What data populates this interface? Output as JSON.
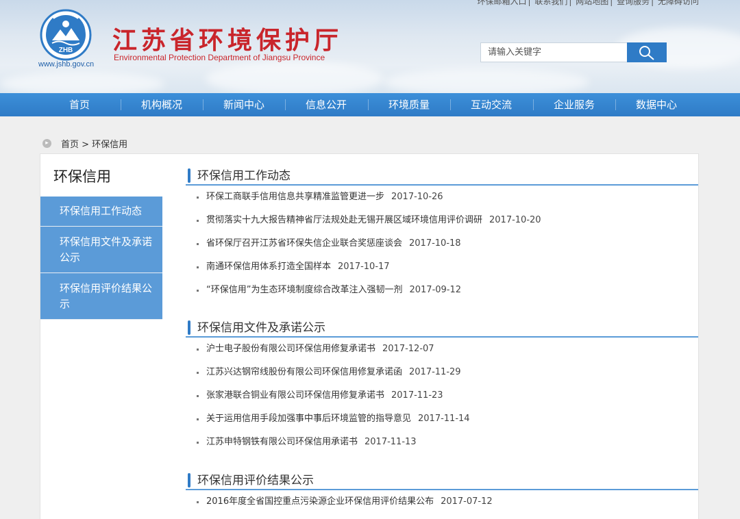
{
  "header": {
    "top_links": [
      "环保邮箱入口",
      "联系我们",
      "网站地图",
      "查询服务",
      "无障碍访问"
    ],
    "logo_text": "ZHB",
    "site_url": "www.jshb.gov.cn",
    "title": "江苏省环境保护厅",
    "subtitle": "Environmental Protection Department of Jiangsu Province",
    "search": {
      "placeholder": "请输入关键字",
      "icon": "search-icon"
    }
  },
  "nav": {
    "items": [
      "首页",
      "机构概况",
      "新闻中心",
      "信息公开",
      "环境质量",
      "互动交流",
      "企业服务",
      "数据中心"
    ]
  },
  "breadcrumb": {
    "icon": "arrow-right-circle-icon",
    "text": "首页 > 环保信用"
  },
  "sidebar": {
    "title": "环保信用",
    "items": [
      "环保信用工作动态",
      "环保信用文件及承诺公示",
      "环保信用评价结果公示"
    ]
  },
  "sections": [
    {
      "title": "环保信用工作动态",
      "items": [
        {
          "title": "环保工商联手信用信息共享精准监管更进一步",
          "date": "2017-10-26"
        },
        {
          "title": "贯彻落实十九大报告精神省厅法规处赴无锡开展区域环境信用评价调研",
          "date": "2017-10-20"
        },
        {
          "title": "省环保厅召开江苏省环保失信企业联合奖惩座谈会",
          "date": "2017-10-18"
        },
        {
          "title": "南通环保信用体系打造全国样本",
          "date": "2017-10-17"
        },
        {
          "title": "“环保信用”为生态环境制度综合改革注入强韧一剂",
          "date": "2017-09-12"
        }
      ]
    },
    {
      "title": "环保信用文件及承诺公示",
      "items": [
        {
          "title": "沪士电子股份有限公司环保信用修复承诺书",
          "date": "2017-12-07"
        },
        {
          "title": "江苏兴达钢帘线股份有限公司环保信用修复承诺函",
          "date": "2017-11-29"
        },
        {
          "title": "张家港联合铜业有限公司环保信用修复承诺书",
          "date": "2017-11-23"
        },
        {
          "title": "关于运用信用手段加强事中事后环境监管的指导意见",
          "date": "2017-11-14"
        },
        {
          "title": "江苏申特钢铁有限公司环保信用承诺书",
          "date": "2017-11-13"
        }
      ]
    },
    {
      "title": "环保信用评价结果公示",
      "items": [
        {
          "title": "2016年度全省国控重点污染源企业环保信用评价结果公布",
          "date": "2017-07-12"
        }
      ]
    }
  ],
  "colors": {
    "brand_red": "#c9252b",
    "nav_blue": "#2f7bc6",
    "side_blue": "#5b9bd8"
  }
}
